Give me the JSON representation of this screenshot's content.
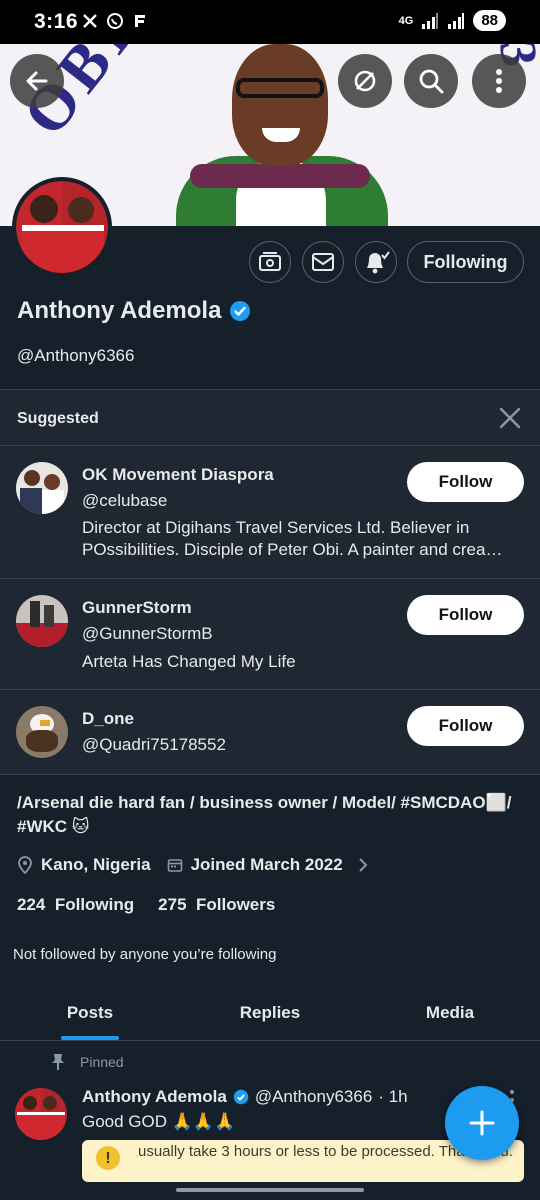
{
  "status_bar": {
    "time": "3:16",
    "network": "4G",
    "battery": "88"
  },
  "profile": {
    "name": "Anthony Ademola",
    "handle": "@Anthony6366",
    "following_label": "Following",
    "bio": "/Arsenal die hard fan / business owner / Model/ #SMCDAO⬜/ #WKC 🐱",
    "location": "Kano, Nigeria",
    "joined": "Joined March 2022",
    "following_count": "224",
    "following_text": "Following",
    "followers_count": "275",
    "followers_text": "Followers",
    "not_followed": "Not followed by anyone you’re following"
  },
  "suggested": {
    "title": "Suggested",
    "follow_label": "Follow",
    "items": [
      {
        "name": "OK Movement Diaspora",
        "handle": "@celubase",
        "bio": "Director at Digihans Travel Services Ltd. Believer in POssibilities. Disciple of Peter Obi. A painter and crea…"
      },
      {
        "name": "GunnerStorm",
        "handle": "@GunnerStormB",
        "bio": "Arteta Has Changed My Life"
      },
      {
        "name": "D_one",
        "handle": "@Quadri75178552",
        "bio": ""
      }
    ]
  },
  "tabs": [
    {
      "label": "Posts",
      "active": true
    },
    {
      "label": "Replies",
      "active": false
    },
    {
      "label": "Media",
      "active": false
    }
  ],
  "post": {
    "pinned_label": "Pinned",
    "author": "Anthony Ademola",
    "handle": "@Anthony6366",
    "time": "· 1h",
    "text": "Good GOD 🙏🙏🙏"
  },
  "toast": {
    "text": "usually take 3 hours or less to be processed. Thank you."
  },
  "colors": {
    "background": "#15202b",
    "panel": "#1e2732",
    "accent": "#1d9bf0",
    "verified": "#1d9bf0"
  }
}
